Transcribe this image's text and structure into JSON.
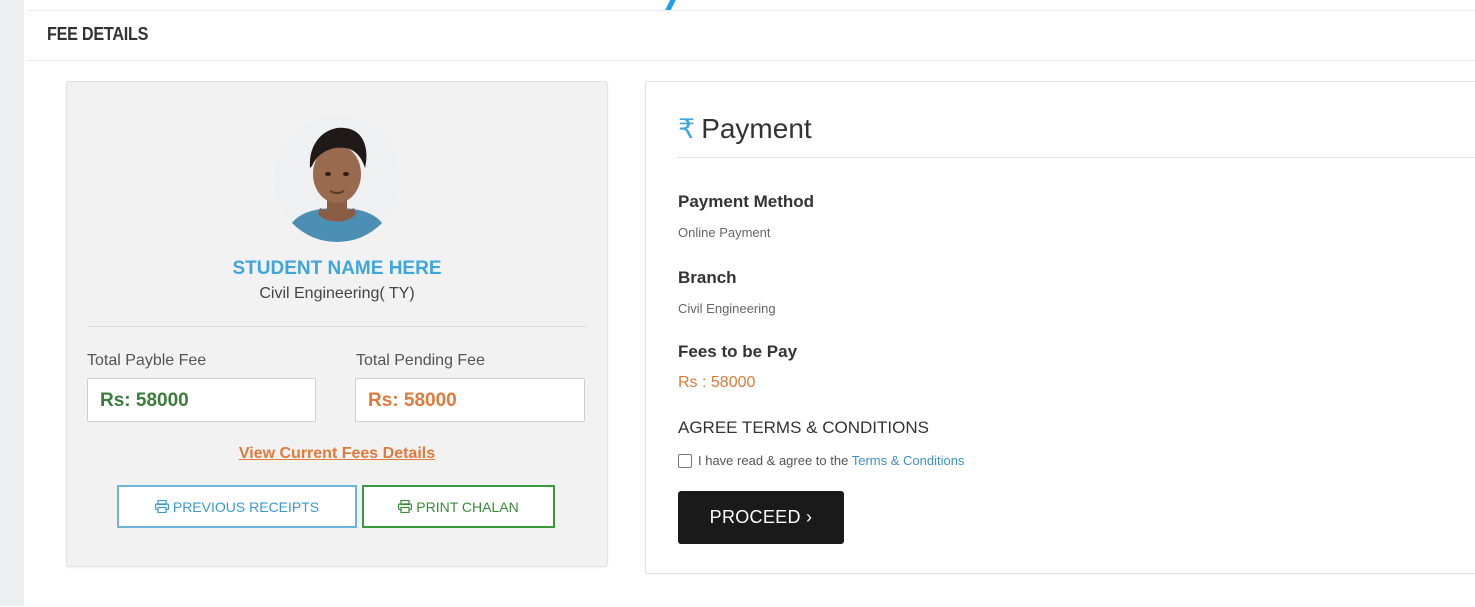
{
  "section": {
    "title": "FEE DETAILS"
  },
  "student": {
    "name": "STUDENT NAME HERE",
    "branch": "Civil Engineering( TY)",
    "total_payable_label": "Total Payble Fee",
    "total_payable_value": "Rs: 58000",
    "total_pending_label": "Total Pending Fee",
    "total_pending_value": "Rs: 58000",
    "view_link": "View Current Fees Details",
    "previous_receipts_label": "PREVIOUS RECEIPTS",
    "print_chalan_label": "PRINT CHALAN"
  },
  "payment": {
    "currency_symbol": "₹",
    "title": "Payment",
    "method_label": "Payment Method",
    "method_value": "Online Payment",
    "branch_label": "Branch",
    "branch_value": "Civil Engineering",
    "fees_label": "Fees to be Pay",
    "fees_value": "Rs : 58000",
    "terms_heading": "AGREE TERMS & CONDITIONS",
    "terms_text": "I have read & agree to the",
    "terms_link": "Terms & Conditions",
    "proceed_label": "PROCEED ›"
  },
  "colors": {
    "accent_blue": "#3ea6dd",
    "payable_green": "#3a7d3a",
    "pending_orange": "#e07a3a",
    "dark_button": "#1a1a1a"
  },
  "icons": {
    "arrow": "arrow-down-left-icon",
    "rupee": "rupee-icon",
    "printer": "printer-icon",
    "checkbox": "checkbox-icon"
  }
}
